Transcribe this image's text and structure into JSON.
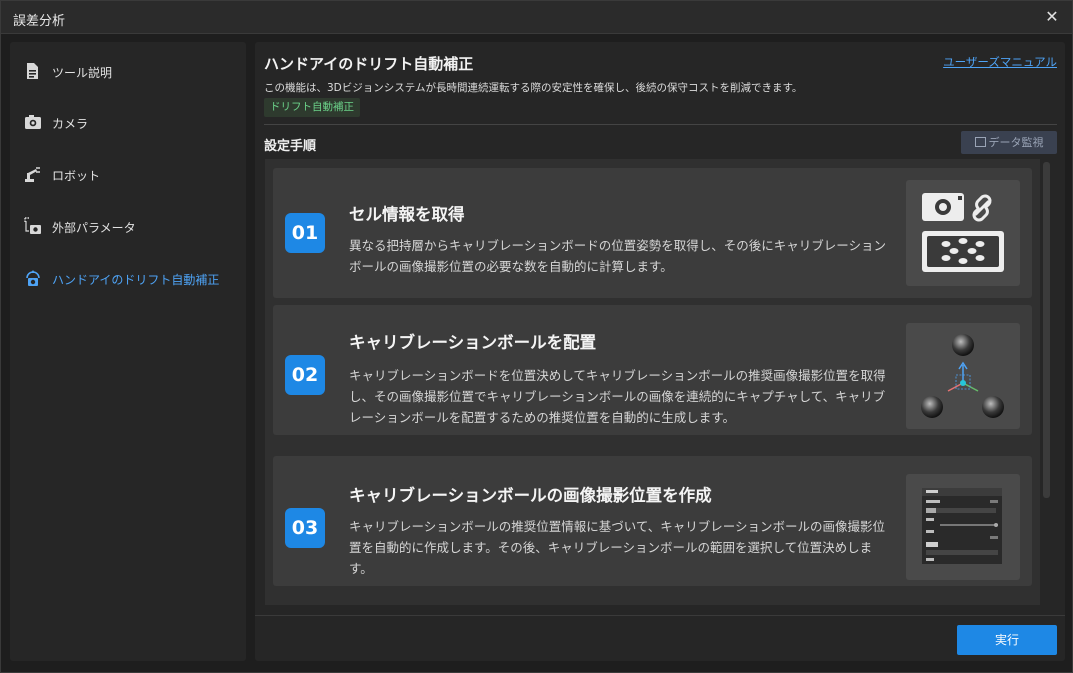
{
  "window": {
    "title": "誤差分析",
    "close_icon": "close-icon"
  },
  "sidebar": {
    "items": [
      {
        "label": "ツール説明",
        "icon": "document-icon"
      },
      {
        "label": "カメラ",
        "icon": "camera-icon"
      },
      {
        "label": "ロボット",
        "icon": "robot-arm-icon"
      },
      {
        "label": "外部パラメータ",
        "icon": "extrinsic-camera-icon"
      },
      {
        "label": "ハンドアイのドリフト自動補正",
        "icon": "hand-eye-drift-icon"
      }
    ],
    "active_index": 4
  },
  "main": {
    "title": "ハンドアイのドリフト自動補正",
    "description": "この機能は、3Dビジョンシステムが長時間連続運転する際の安定性を確保し、後続の保守コストを削減できます。",
    "manual_link": "ユーザーズマニュアル",
    "tag": "ドリフト自動補正",
    "steps_title": "設定手順",
    "monitor_button": "データ監視",
    "steps": [
      {
        "number": "01",
        "title": "セル情報を取得",
        "description": "異なる把持層からキャリブレーションボードの位置姿勢を取得し、その後にキャリブレーションボールの画像撮影位置の必要な数を自動的に計算します。",
        "thumb_icon": "camera-link-board-icon"
      },
      {
        "number": "02",
        "title": "キャリブレーションボールを配置",
        "description": "キャリブレーションボードを位置決めしてキャリブレーションボールの推奨画像撮影位置を取得し、その画像撮影位置でキャリブレーションボールの画像を連続的にキャプチャして、キャリブレーションボールを配置するための推奨位置を自動的に生成します。",
        "thumb_icon": "calibration-balls-axes-icon"
      },
      {
        "number": "03",
        "title": "キャリブレーションボールの画像撮影位置を作成",
        "description": "キャリブレーションボールの推奨位置情報に基づいて、キャリブレーションボールの画像撮影位置を自動的に作成します。その後、キャリブレーションボールの範囲を選択して位置決めします。",
        "thumb_icon": "settings-panel-preview-icon"
      }
    ],
    "run_button": "実行"
  },
  "colors": {
    "accent": "#1e88e5",
    "link": "#4ea3f5",
    "tag_text": "#6cd38a",
    "background": "#1e1e1e",
    "panel": "#262626",
    "card": "#3c3c3c"
  }
}
